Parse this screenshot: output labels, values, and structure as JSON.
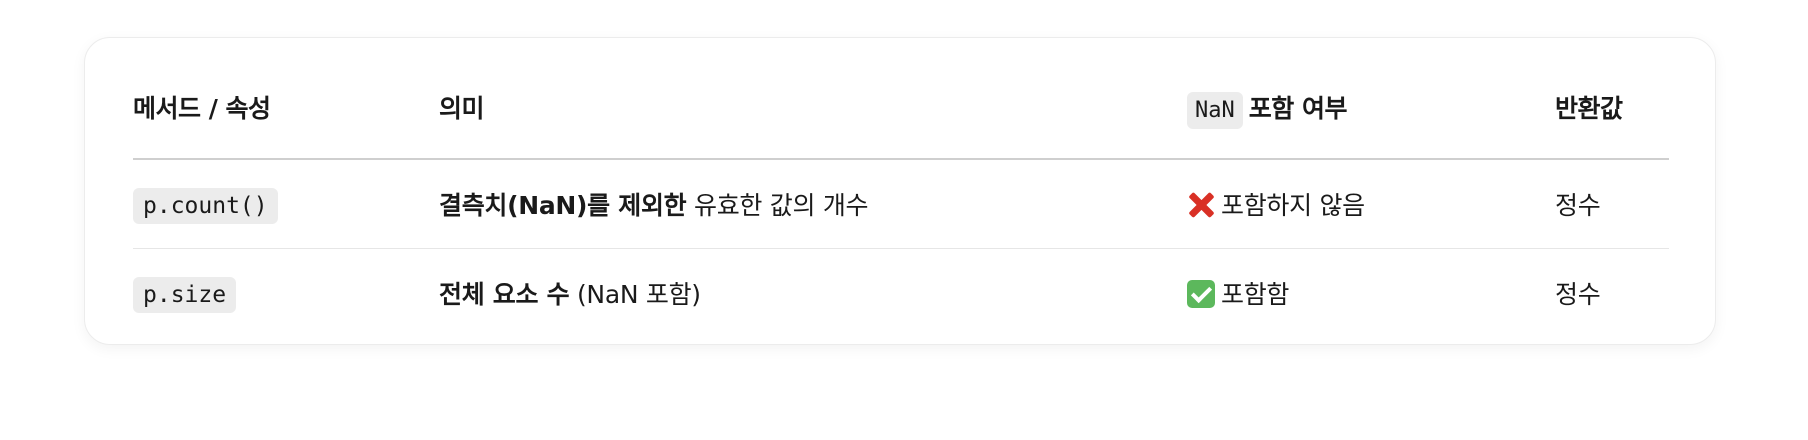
{
  "table": {
    "headers": {
      "method": "메서드 / 속성",
      "meaning": "의미",
      "nan_code": "NaN",
      "nan_label": "포함 여부",
      "return": "반환값"
    },
    "rows": [
      {
        "code": "p.count()",
        "meaning_bold": "결측치(NaN)를 제외한",
        "meaning_rest": " 유효한 값의 개수",
        "nan_icon": "cross-mark-icon",
        "nan_text": "포함하지 않음",
        "return": "정수"
      },
      {
        "code": "p.size",
        "meaning_bold": "전체 요소 수",
        "meaning_rest": " (NaN 포함)",
        "nan_icon": "check-mark-icon",
        "nan_text": "포함함",
        "return": "정수"
      }
    ]
  },
  "colors": {
    "cross": "#d93025",
    "check": "#5cb85c",
    "code_bg": "#ececec"
  }
}
